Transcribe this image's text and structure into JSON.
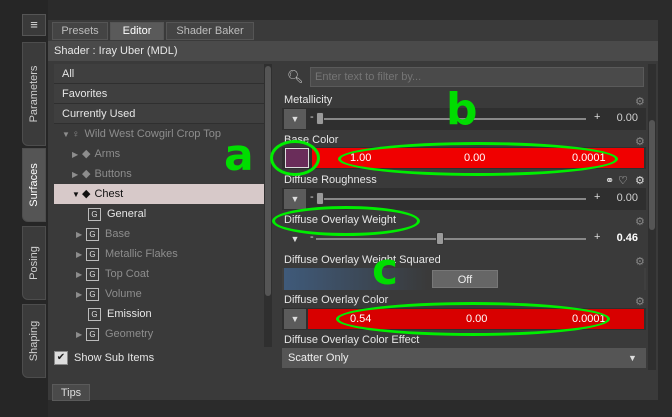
{
  "rail": {
    "menu_icon": "≡",
    "tabs": [
      "Parameters",
      "Surfaces",
      "Posing",
      "Shaping"
    ]
  },
  "tabs": [
    "Presets",
    "Editor",
    "Shader Baker"
  ],
  "shader_bar": "Shader : Iray Uber (MDL)",
  "left_list": {
    "headers": [
      "All",
      "Favorites",
      "Currently Used"
    ],
    "figure": "Wild West Cowgirl Crop Top",
    "groups": [
      "Arms",
      "Buttons",
      "Chest"
    ],
    "chest_items": [
      "General",
      "Base",
      "Metallic Flakes",
      "Top Coat",
      "Volume",
      "Emission",
      "Geometry"
    ],
    "show_sub_items": "Show Sub Items",
    "check": "✔"
  },
  "filter": {
    "placeholder": "Enter text to filter by..."
  },
  "properties": {
    "metallicity": {
      "label": "Metallicity",
      "value": "0.00"
    },
    "base_color": {
      "label": "Base Color",
      "r": "1.00",
      "g": "0.00",
      "b": "0.0001"
    },
    "diffuse_roughness": {
      "label": "Diffuse Roughness",
      "value": "0.00"
    },
    "diffuse_overlay_weight": {
      "label": "Diffuse Overlay Weight",
      "value": "0.46",
      "fraction": 0.46
    },
    "diffuse_overlay_weight_squared": {
      "label": "Diffuse Overlay Weight Squared",
      "button": "Off"
    },
    "diffuse_overlay_color": {
      "label": "Diffuse Overlay Color",
      "r": "0.54",
      "g": "0.00",
      "b": "0.0001"
    },
    "diffuse_overlay_color_effect": {
      "label": "Diffuse Overlay Color Effect",
      "value": "Scatter Only"
    }
  },
  "bottom": {
    "tips": "Tips"
  },
  "annotations": {
    "a": "a",
    "b": "b",
    "c": "c"
  },
  "colors": {
    "accent_red": "#f00000",
    "annotation_green": "#00ee00",
    "swatch": "#6a2d5a"
  }
}
